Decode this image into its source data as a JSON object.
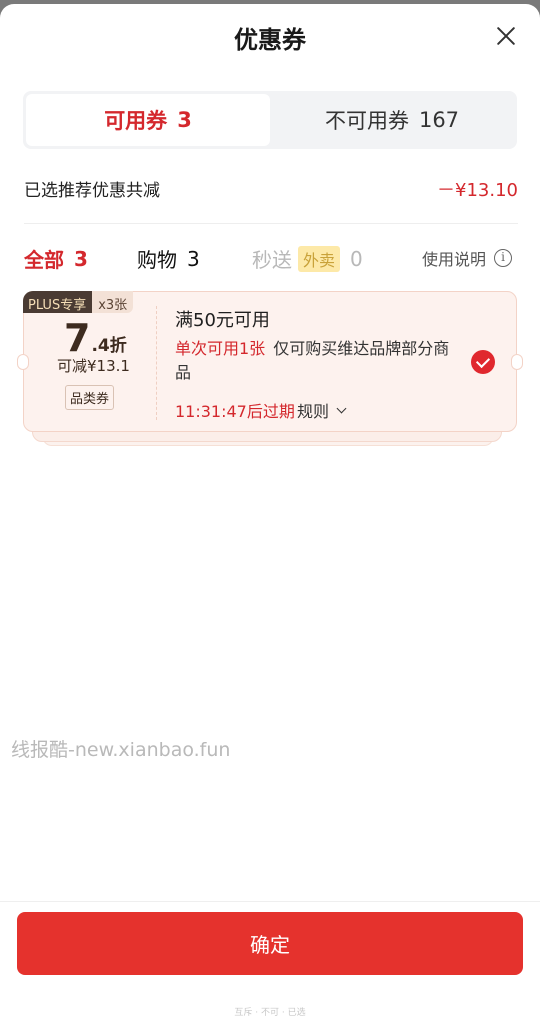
{
  "header": {
    "title": "优惠券"
  },
  "tabs": {
    "available": {
      "label": "可用券",
      "count": "3"
    },
    "unavailable": {
      "label": "不可用券",
      "count": "167"
    }
  },
  "summary": {
    "label": "已选推荐优惠共减",
    "amount": "－¥13.10"
  },
  "filters": {
    "all": {
      "label": "全部",
      "count": "3"
    },
    "shopping": {
      "label": "购物",
      "count": "3"
    },
    "flash": {
      "label": "秒送",
      "tag": "外卖",
      "count": "0"
    },
    "usage_label": "使用说明",
    "info_glyph": "i"
  },
  "coupon": {
    "plus_label": "PLUS专享",
    "quantity": "x3张",
    "discount_int": "7",
    "discount_unit": ".4折",
    "reduce_text": "可减¥13.1",
    "category_tag": "品类券",
    "threshold": "满50元可用",
    "limit_text": "单次可用1张",
    "desc_text": "仅可购买维达品牌部分商品",
    "expire_text": "11:31:47后过期",
    "rules_label": "规则",
    "selected": true
  },
  "watermark": "线报酷-new.xianbao.fun",
  "footer": {
    "confirm_label": "确定",
    "note": "互斥 · 不可 · 已选"
  },
  "colors": {
    "accent": "#d4282d",
    "button": "#e5322d",
    "coupon_bg": "#fdf2ee"
  }
}
